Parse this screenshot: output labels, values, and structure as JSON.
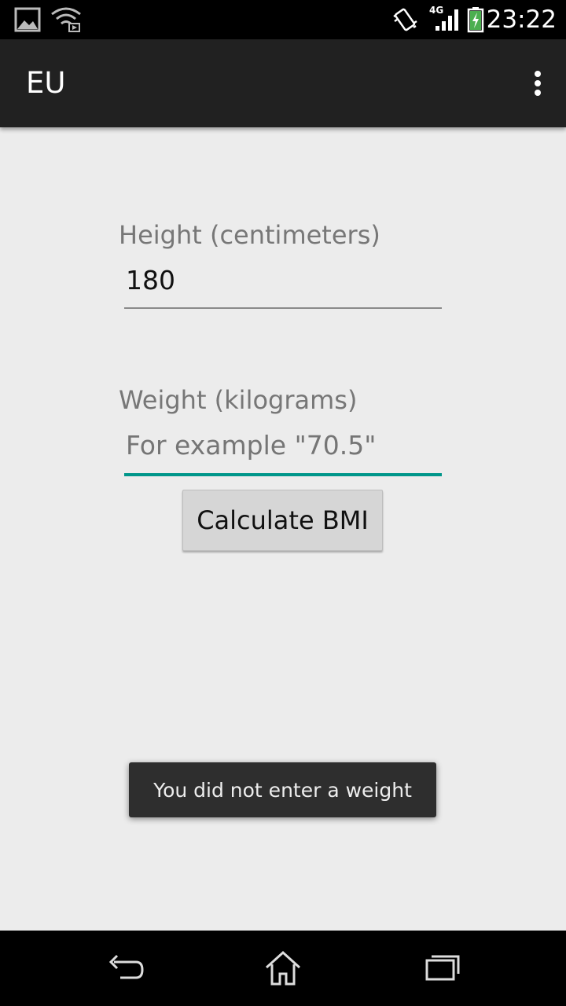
{
  "status_bar": {
    "time": "23:22",
    "network_label": "4G",
    "icons": [
      "gallery-icon",
      "wifi-cast-icon",
      "vibrate-icon",
      "signal-icon",
      "battery-charging-icon"
    ]
  },
  "action_bar": {
    "title": "EU",
    "overflow_icon": "overflow-menu-icon"
  },
  "form": {
    "height_label": "Height (centimeters)",
    "height_value": "180",
    "weight_label": "Weight (kilograms)",
    "weight_value": "",
    "weight_placeholder": "For example \"70.5\"",
    "calculate_label": "Calculate BMI"
  },
  "toast": {
    "message": "You did not enter a weight"
  },
  "nav_bar": {
    "buttons": [
      "back-icon",
      "home-icon",
      "recents-icon"
    ]
  },
  "colors": {
    "accent": "#00968a",
    "action_bar": "#212121",
    "background": "#ececec"
  }
}
